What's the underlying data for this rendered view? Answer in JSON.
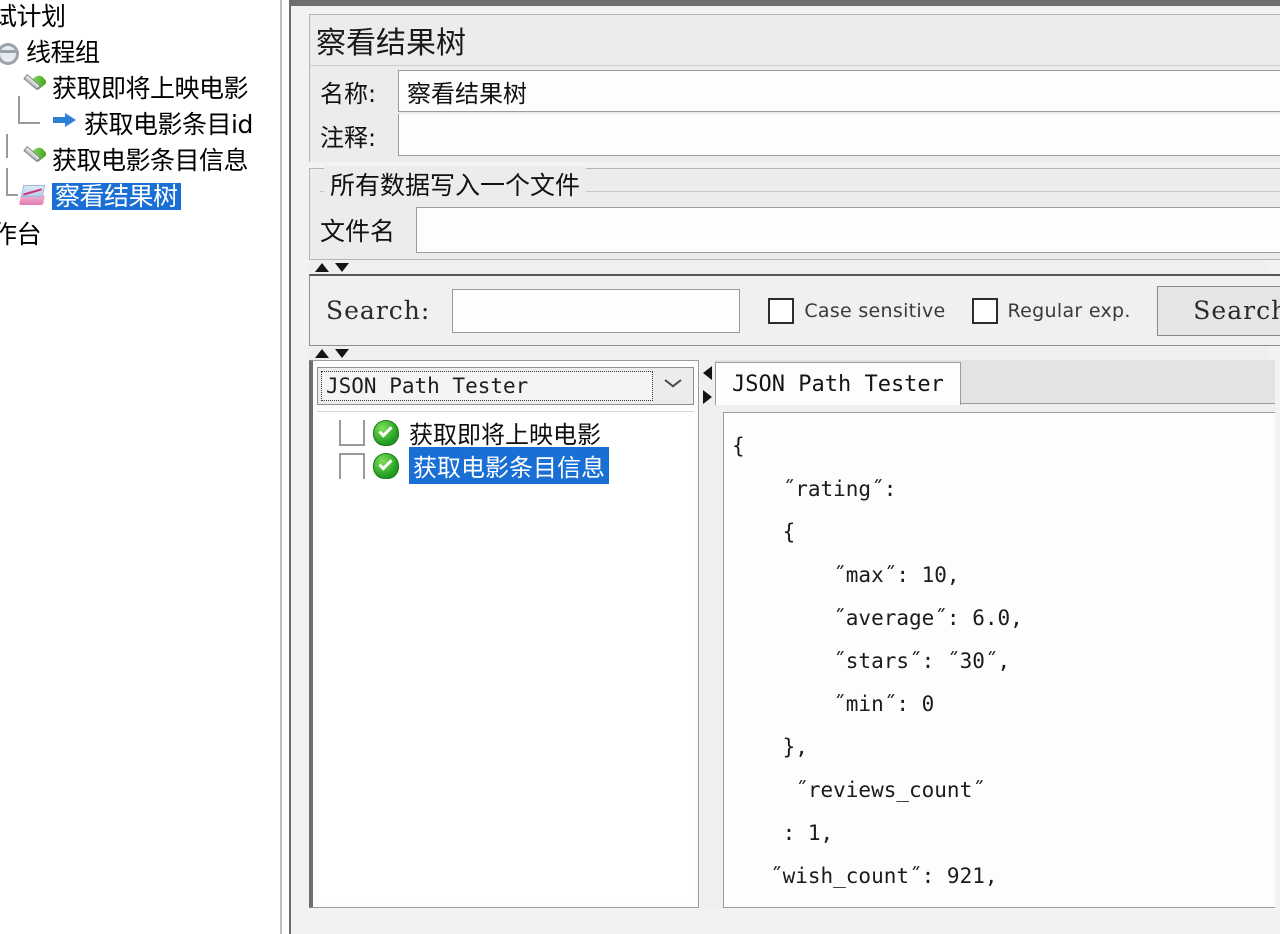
{
  "sidebar": {
    "name": "test-plan-tree",
    "nodes": [
      {
        "label": "试计划",
        "icon": "test-plan-icon",
        "indent": 0,
        "selected": false,
        "icon_visible": false
      },
      {
        "label": "线程组",
        "icon": "gear-icon",
        "indent": 0,
        "selected": false,
        "icon_visible": true
      },
      {
        "label": "获取即将上映电影",
        "icon": "pipette-icon",
        "indent": 1,
        "selected": false,
        "icon_visible": true
      },
      {
        "label": "获取电影条目id",
        "icon": "blue-arrow-icon",
        "indent": 2,
        "selected": false,
        "icon_visible": true
      },
      {
        "label": "获取电影条目信息",
        "icon": "pipette-icon",
        "indent": 1,
        "selected": false,
        "icon_visible": true
      },
      {
        "label": "察看结果树",
        "icon": "results-chart-icon",
        "indent": 1,
        "selected": true,
        "icon_visible": true
      },
      {
        "label": "作台",
        "icon": "workbench-icon",
        "indent": 0,
        "selected": false,
        "icon_visible": false
      }
    ]
  },
  "panel": {
    "title": "察看结果树",
    "name_label": "名称:",
    "name_value": "察看结果树",
    "comment_label": "注释:",
    "comment_value": ""
  },
  "file_group": {
    "legend": "所有数据写入一个文件",
    "filename_label": "文件名",
    "filename_value": ""
  },
  "search": {
    "label": "Search:",
    "value": "",
    "case_sensitive_label": "Case sensitive",
    "case_sensitive_checked": false,
    "regular_exp_label": "Regular exp.",
    "regular_exp_checked": false,
    "search_button": "Search",
    "reset_button": ""
  },
  "renderer": {
    "combo_selected": "JSON Path Tester",
    "results": [
      {
        "label": "获取即将上映电影",
        "status": "success",
        "selected": false
      },
      {
        "label": "获取电影条目信息",
        "status": "success",
        "selected": true
      }
    ]
  },
  "json_view": {
    "tab_label": "JSON Path Tester",
    "lines": [
      "{",
      "    ˝rating˝:",
      "    {",
      "        ˝max˝: 10,",
      "        ˝average˝: 6.0,",
      "        ˝stars˝: ˝30˝,",
      "        ˝min˝: 0",
      "    },",
      "     ˝reviews_count˝",
      "    : 1,",
      "   ˝wish_count˝: 921,"
    ]
  },
  "colors": {
    "selection_blue": "#1a6fd4",
    "panel_bg": "#ececec",
    "window_chrome": "#6e6e6e",
    "status_green": "#1f9a1f"
  }
}
